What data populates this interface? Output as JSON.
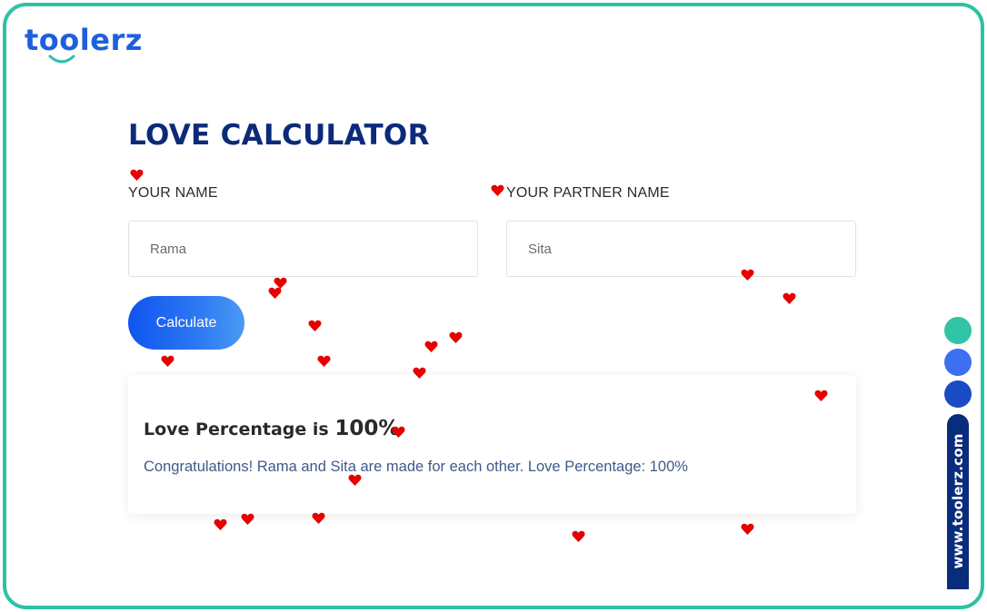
{
  "logo": {
    "text": "toolerz"
  },
  "page": {
    "title": "LOVE CALCULATOR"
  },
  "form": {
    "your_name_label": "YOUR NAME",
    "partner_name_label": "YOUR PARTNER NAME",
    "your_name_value": "Rama",
    "partner_name_value": "Sita",
    "calculate_label": "Calculate"
  },
  "result": {
    "heading_prefix": "Love Percentage is",
    "percentage": "100%",
    "message": "Congratulations! Rama and Sita are made for each other. Love Percentage: 100%"
  },
  "side_nav": {
    "dots": [
      "#2fc4a6",
      "#3d6ff2",
      "#1a4bc4"
    ],
    "banner_text": "www.toolerz.com"
  },
  "colors": {
    "frame_border": "#2dc2a4",
    "title": "#0b2a7a",
    "accent": "#1e5fe0",
    "heart": "#e60000",
    "message": "#3e5a8a"
  }
}
